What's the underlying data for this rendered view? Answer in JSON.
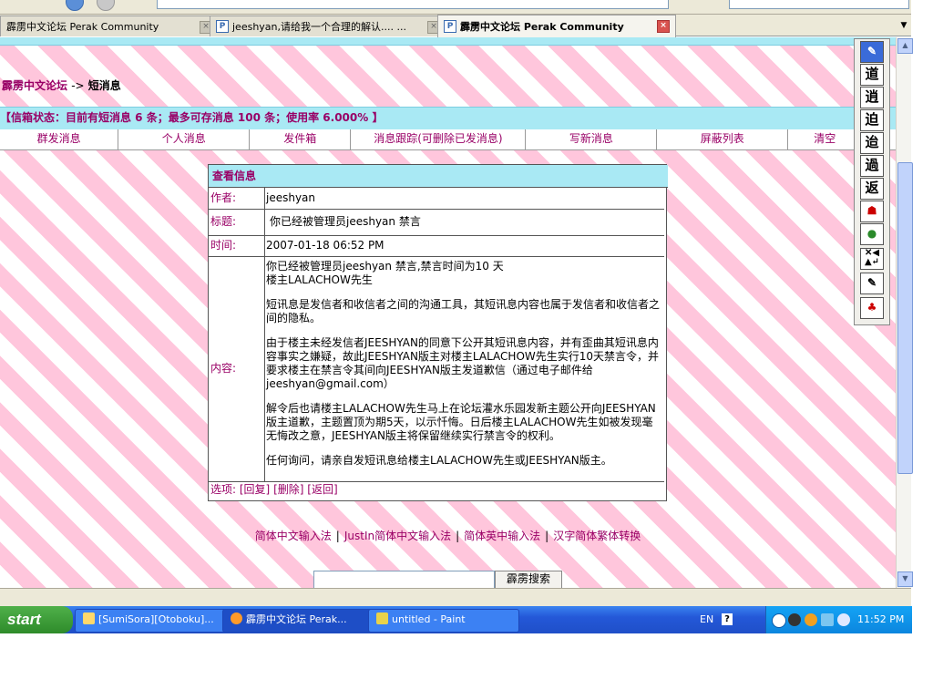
{
  "browser": {
    "tabs": [
      {
        "label": "霹雳中文论坛 Perak Community",
        "active": false
      },
      {
        "label": "jeeshyan,请给我一个合理的解认.... ...",
        "active": false
      },
      {
        "label": "霹雳中文论坛 Perak Community",
        "active": true
      }
    ]
  },
  "page": {
    "breadcrumb": {
      "home": "霹雳中文论坛",
      "arrow": "->",
      "current": "短消息"
    },
    "mailbox_status": "【信箱状态：目前有短消息 6 条；最多可存消息 100 条；使用率 6.000% 】",
    "menu": [
      "群发消息",
      "个人消息",
      "发件箱",
      "消息跟踪(可删除已发消息)",
      "写新消息",
      "屏蔽列表",
      "清空"
    ],
    "message": {
      "header": "查看信息",
      "author_label": "作者:",
      "author": "jeeshyan",
      "title_label": "标题:",
      "title": "你已经被管理员jeeshyan 禁言",
      "time_label": "时间:",
      "time": "2007-01-18 06:52 PM",
      "content_label": "内容:",
      "content_paragraphs": [
        "你已经被管理员jeeshyan 禁言,禁言时间为10 天\n楼主LALACHOW先生",
        "短讯息是发信者和收信者之间的沟通工具，其短讯息内容也属于发信者和收信者之间的隐私。",
        "由于楼主未经发信者JEESHYAN的同意下公开其短讯息内容，并有歪曲其短讯息内容事实之嫌疑，故此JEESHYAN版主对楼主LALACHOW先生实行10天禁言令，并要求楼主在禁言令其间向JEESHYAN版主发道歉信（通过电子邮件给jeeshyan@gmail.com）",
        "解令后也请楼主LALACHOW先生马上在论坛灌水乐园发新主题公开向JEESHYAN版主道歉，主题置顶为期5天，以示忏悔。日后楼主LALACHOW先生如被发现毫无悔改之意，JEESHYAN版主将保留继续实行禁言令的权利。",
        "任何询问，请亲自发短讯息给楼主LALACHOW先生或JEESHYAN版主。"
      ],
      "options_label": "选项:",
      "reply": "[回复]",
      "delete": "[删除]",
      "back": "[返回]"
    },
    "footer_links": [
      "简体中文输入法",
      "JustIn简体中文输入法",
      "简体英中输入法",
      "汉字简体繁体转换"
    ],
    "search_button": "霹雳搜索"
  },
  "ime_toolbar": [
    "道",
    "逍",
    "迫",
    "迨",
    "過",
    "返"
  ],
  "taskbar": {
    "start": "start",
    "tasks": [
      {
        "label": "[SumiSora][Otoboku]...",
        "active": false
      },
      {
        "label": "霹雳中文论坛 Perak...",
        "active": true
      },
      {
        "label": "untitled - Paint",
        "active": false
      }
    ],
    "language": "EN",
    "clock": "11:52 PM"
  },
  "colors": {
    "link": "#990066",
    "cyan": "#a9e9f4",
    "stripe": "#ffc6dc"
  }
}
